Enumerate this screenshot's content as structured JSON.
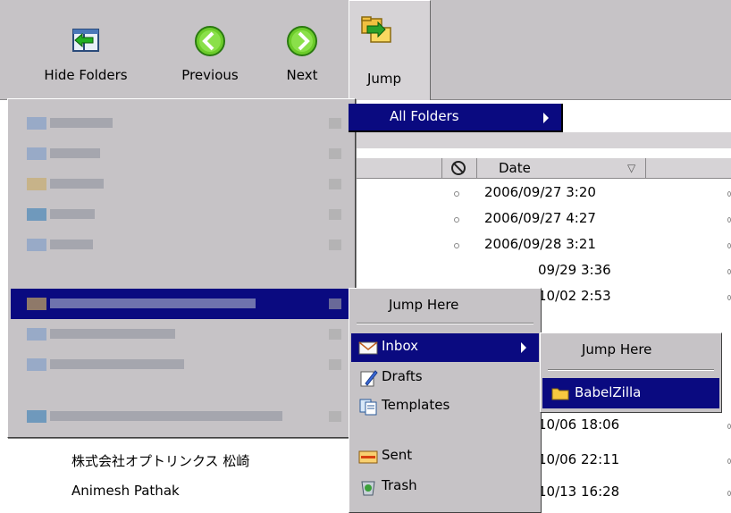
{
  "toolbar": {
    "hide_folders": "Hide Folders",
    "previous": "Previous",
    "next": "Next",
    "jump": "Jump"
  },
  "column_header": {
    "date": "Date"
  },
  "rows": [
    {
      "date": "2006/09/27 3:20"
    },
    {
      "date": "2006/09/27 4:27"
    },
    {
      "date": "2006/09/28 3:21"
    },
    {
      "date": "09/29 3:36"
    },
    {
      "date": "10/02 2:53"
    },
    {
      "date": "10/06 18:06"
    },
    {
      "date": "10/06 22:11"
    },
    {
      "date": "10/13 16:28"
    }
  ],
  "senders": [
    "株式会社オプトリンクス 松崎",
    "Animesh Pathak"
  ],
  "jump_menu": {
    "all_folders": "All Folders"
  },
  "folder_submenu": {
    "jump_here": "Jump Here",
    "items": [
      {
        "label": "Inbox",
        "icon": "inbox-icon"
      },
      {
        "label": "Drafts",
        "icon": "drafts-icon"
      },
      {
        "label": "Templates",
        "icon": "templates-icon"
      },
      {
        "label": "Sent",
        "icon": "sent-icon"
      },
      {
        "label": "Trash",
        "icon": "trash-icon"
      }
    ]
  },
  "inbox_submenu": {
    "jump_here": "Jump Here",
    "items": [
      {
        "label": "BabelZilla",
        "icon": "folder-icon"
      }
    ]
  },
  "colors": {
    "toolbar": "#c6c3c6",
    "selection": "#0a0a80",
    "menu": "#c6c3c6"
  }
}
